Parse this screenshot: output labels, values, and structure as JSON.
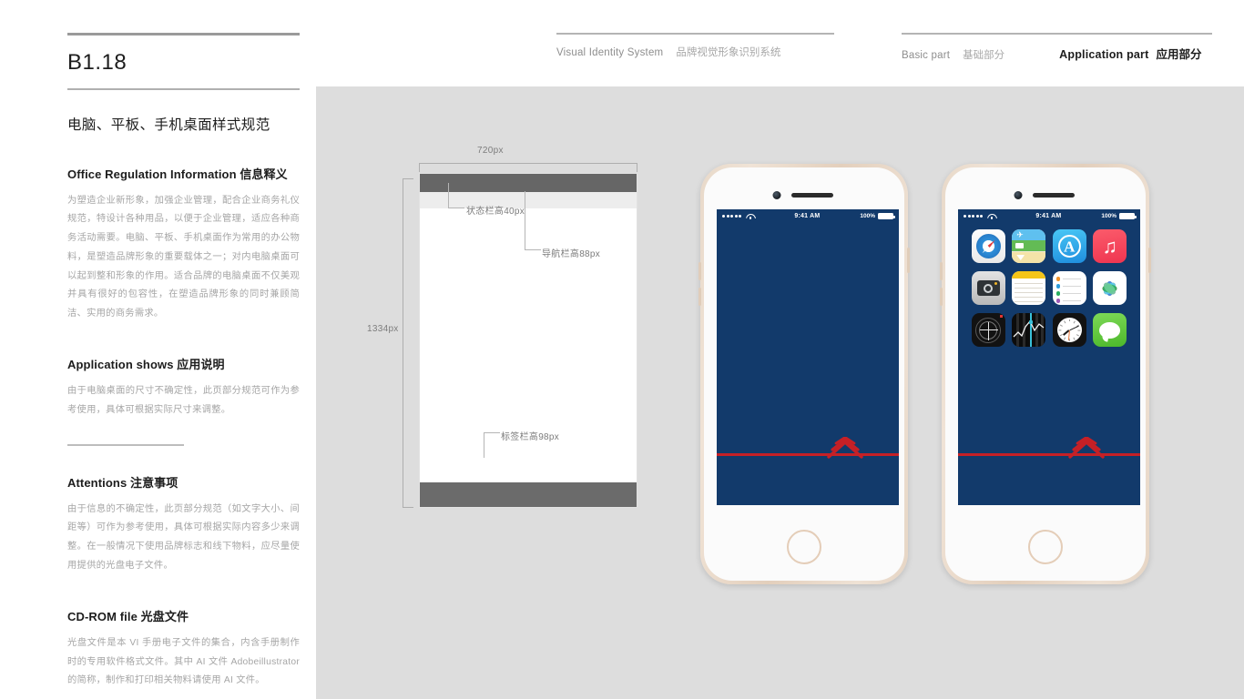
{
  "header": {
    "group1": {
      "en": "Visual Identity System",
      "cn": "品牌视觉形象识别系统"
    },
    "group2": {
      "basic_en": "Basic part",
      "basic_cn": "基础部分",
      "application_en": "Application part",
      "application_cn": "应用部分"
    }
  },
  "left": {
    "doc_code": "B1.18",
    "doc_title": "电脑、平板、手机桌面样式规范",
    "sections": [
      {
        "head": "Office Regulation Information 信息释义",
        "body": "为塑造企业新形象，加强企业管理，配合企业商务礼仪规范，特设计各种用品，以便于企业管理，适应各种商务活动需要。电脑、平板、手机桌面作为常用的办公物料，是塑造品牌形象的重要载体之一；对内电脑桌面可以起到整和形象的作用。适合品牌的电脑桌面不仅美观并具有很好的包容性，在塑造品牌形象的同时兼顾简洁、实用的商务需求。"
      },
      {
        "head": "Application shows 应用说明",
        "body": "由于电脑桌面的尺寸不确定性，此页部分规范可作为参考使用，具体可根据实际尺寸来调整。"
      },
      {
        "head": "Attentions 注意事项",
        "body": "由于信息的不确定性，此页部分规范（如文字大小、间距等）可作为参考使用，具体可根据实际内容多少来调整。在一般情况下使用品牌标志和线下物料，应尽量使用提供的光盘电子文件。"
      },
      {
        "head": "CD-ROM file 光盘文件",
        "body": "光盘文件是本 VI 手册电子文件的集合，内含手册制作时的专用软件格式文件。其中 AI 文件 Adobeillustrator 的简称，制作和打印相关物料请使用 AI 文件。"
      }
    ]
  },
  "wireframe": {
    "width_label": "720px",
    "height_label": "1334px",
    "status_bar_label": "状态栏高40px",
    "nav_bar_label": "导航栏高88px",
    "tab_bar_label": "标签栏高98px"
  },
  "phones": [
    {
      "id": "phone-lockscreen",
      "status": {
        "time": "9:41 AM",
        "battery_percent": "100%",
        "carrier_dots": 5
      },
      "has_app_grid": false
    },
    {
      "id": "phone-homescreen",
      "status": {
        "time": "9:41 AM",
        "battery_percent": "100%",
        "carrier_dots": 5
      },
      "has_app_grid": true,
      "apps": [
        "Safari",
        "Maps",
        "App Store",
        "Music",
        "Camera",
        "Notes",
        "Reminders",
        "Photos",
        "Compass",
        "Stocks",
        "Clock",
        "Messages"
      ]
    }
  ],
  "colors": {
    "panel_gray": "#dddddd",
    "wallpaper_navy": "#123a6b",
    "logo_red": "#c62026",
    "wire_status_gray": "#666666",
    "wire_nav_gray": "#ededed",
    "wire_tab_gray": "#6b6b6b",
    "phone_body_gold": "#e4cdb8"
  }
}
